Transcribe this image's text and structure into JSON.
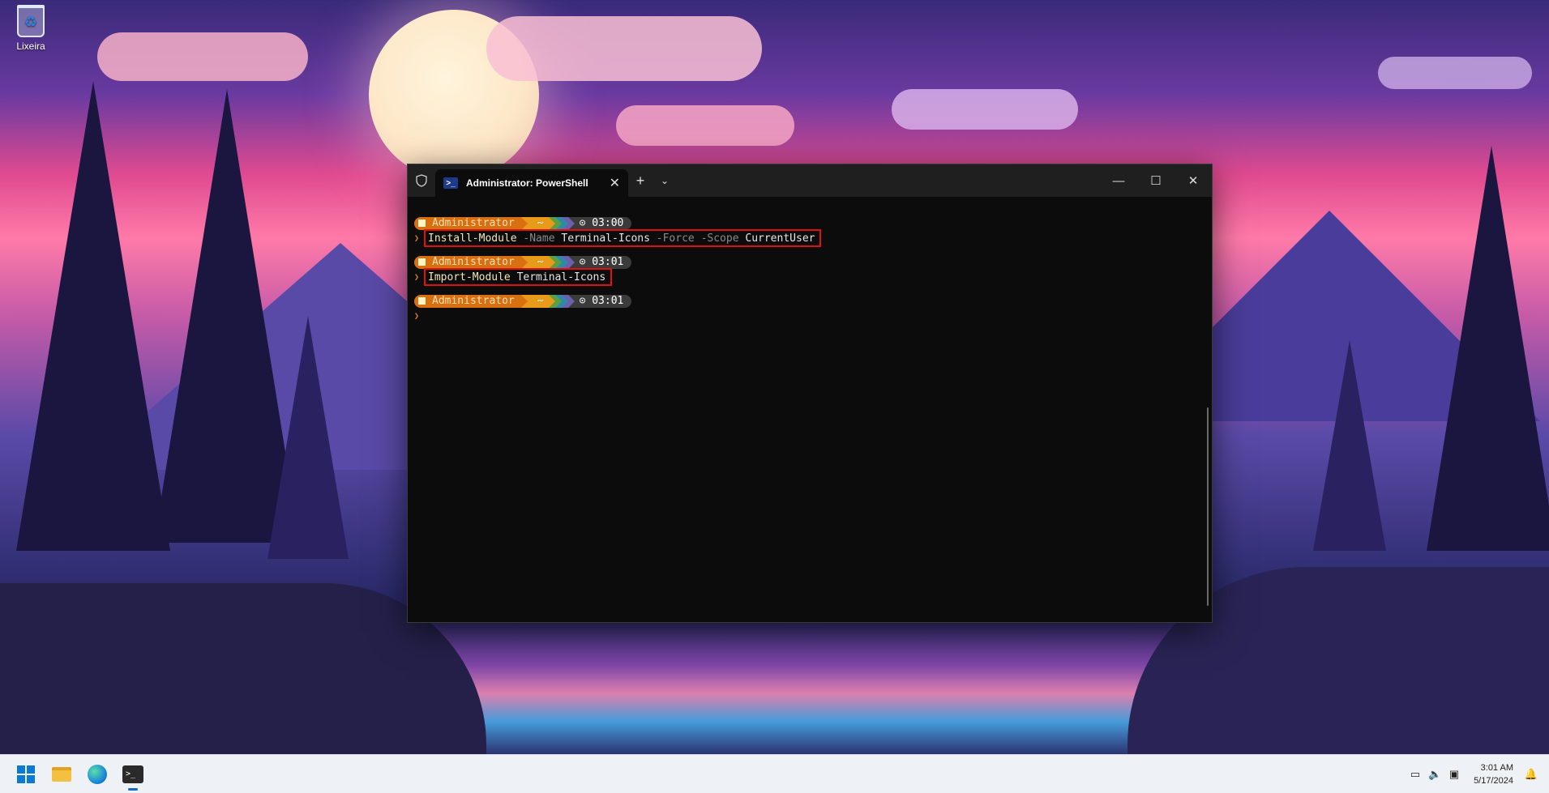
{
  "desktop": {
    "recycle_bin_label": "Lixeira"
  },
  "terminal": {
    "tab_title": "Administrator: PowerShell",
    "icons": {
      "shield": "shield-icon",
      "powershell": "powershell-icon",
      "close_tab": "close-icon",
      "new_tab": "plus-icon",
      "dropdown": "chevron-down-icon",
      "minimize": "minimize-icon",
      "maximize": "maximize-icon",
      "close_window": "close-icon"
    },
    "blocks": [
      {
        "prompt": {
          "user": "Administrator",
          "path": "~",
          "time": "03:00"
        },
        "command": {
          "cmdlet": "Install-Module",
          "parts": [
            {
              "type": "param",
              "text": "-Name"
            },
            {
              "type": "arg",
              "text": "Terminal-Icons"
            },
            {
              "type": "param",
              "text": "-Force"
            },
            {
              "type": "param",
              "text": "-Scope"
            },
            {
              "type": "arg",
              "text": "CurrentUser"
            }
          ]
        }
      },
      {
        "prompt": {
          "user": "Administrator",
          "path": "~",
          "time": "03:01"
        },
        "command": {
          "cmdlet": "Import-Module",
          "parts": [
            {
              "type": "arg",
              "text": "Terminal-Icons"
            }
          ]
        }
      },
      {
        "prompt": {
          "user": "Administrator",
          "path": "~",
          "time": "03:01"
        },
        "command": null
      }
    ],
    "colors": {
      "highlight_box": "#e01010",
      "admin_segment": "#d9700f",
      "path_segment": "#e89a1a",
      "background": "#0c0c0c"
    }
  },
  "taskbar": {
    "apps": [
      "start-icon",
      "file-explorer-icon",
      "edge-icon",
      "terminal-icon"
    ],
    "active_app": "terminal",
    "tray_icons": [
      "network-icon",
      "volume-icon",
      "battery-icon"
    ],
    "time": "3:01 AM",
    "date": "5/17/2024",
    "notification_icon": "bell-icon"
  }
}
